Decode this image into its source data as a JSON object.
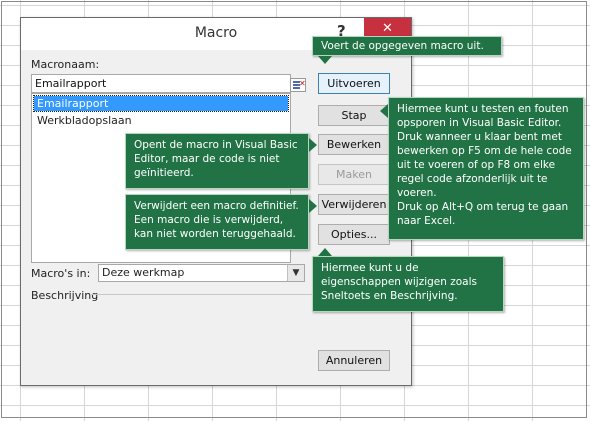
{
  "dialog": {
    "title": "Macro",
    "help_glyph": "?",
    "close_glyph": "✕",
    "macro_name_label": "Macronaam:",
    "macro_name_value": "Emailrapport",
    "macros": [
      "Emailrapport",
      "Werkbladopslaan"
    ],
    "selected_macro": "Emailrapport",
    "macros_in_label": "Macro's in:",
    "macros_in_value": "Deze werkmap",
    "description_label": "Beschrijving",
    "buttons": {
      "run": "Uitvoeren",
      "step": "Stap",
      "edit": "Bewerken",
      "create": "Maken",
      "delete": "Verwijderen",
      "options": "Opties...",
      "cancel": "Annuleren"
    }
  },
  "callouts": {
    "run": "Voert de opgegeven macro uit.",
    "step": "Hiermee kunt u testen en fouten opsporen in Visual Basic Editor. Druk wanneer u klaar bent met bewerken op F5 om de hele code uit te voeren of op F8 om elke regel code afzonderlijk uit te voeren.\nDruk op Alt+Q om terug te gaan naar Excel.",
    "edit": "Opent de macro in Visual Basic Editor, maar de code is niet geïnitieerd.",
    "delete": "Verwijdert een macro definitief. Een macro die is verwijderd, kan niet worden teruggehaald.",
    "options": "Hiermee kunt u de eigenschappen wijzigen zoals Sneltoets en Beschrijving."
  },
  "colors": {
    "callout_green": "#217346",
    "close_red": "#c7303f",
    "selection_blue": "#3399ff"
  }
}
